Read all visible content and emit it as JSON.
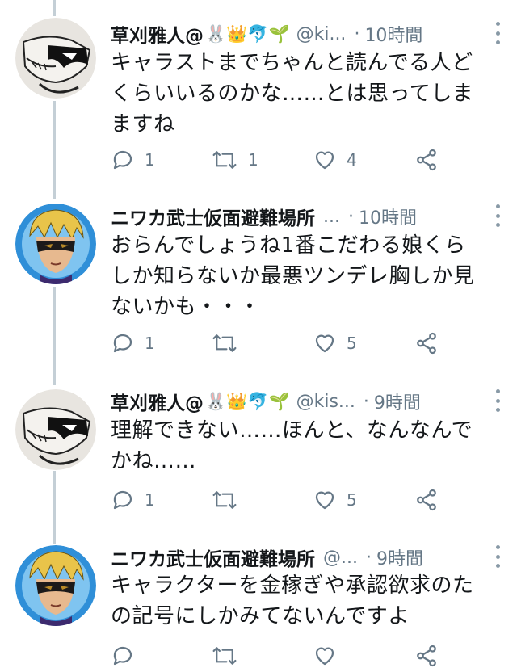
{
  "colors": {
    "text": "#14171a",
    "muted": "#657786",
    "line": "#c4cfd6",
    "icon": "#657786"
  },
  "tweets": [
    {
      "name": "草刈雅人@",
      "emojis": "🐰👑🐬🌱",
      "handle": "@ki...",
      "sep": "·",
      "time": "10時間",
      "lines": [
        "キャラストまでちゃんと読んでる人ど",
        "くらいいるのかな……とは思ってしま",
        "ますね"
      ],
      "reply_count": "1",
      "retweet_count": "1",
      "like_count": "4",
      "avatar": "monochrome-masked-avatar"
    },
    {
      "name": "ニワカ武士仮面避難場所",
      "emojis": "",
      "handle": "...",
      "sep": "·",
      "time": "10時間",
      "lines": [
        "おらんでしょうね1番こだわる娘くら",
        "しか知らないか最悪ツンデレ胸しか見",
        "ないかも・・・"
      ],
      "reply_count": "1",
      "retweet_count": "",
      "like_count": "5",
      "avatar": "blonde-masked-avatar"
    },
    {
      "name": "草刈雅人@",
      "emojis": "🐰👑🐬🌱",
      "handle": "@kis...",
      "sep": "·",
      "time": "9時間",
      "lines": [
        "理解できない……ほんと、なんなんで",
        "かね……"
      ],
      "reply_count": "1",
      "retweet_count": "",
      "like_count": "5",
      "avatar": "monochrome-masked-avatar"
    },
    {
      "name": "ニワカ武士仮面避難場所",
      "emojis": "",
      "handle": "@...",
      "sep": "·",
      "time": "9時間",
      "lines": [
        "キャラクターを金稼ぎや承認欲求のた",
        "の記号にしかみてないんですよ"
      ],
      "reply_count": "",
      "retweet_count": "",
      "like_count": "",
      "avatar": "blonde-masked-avatar"
    }
  ]
}
